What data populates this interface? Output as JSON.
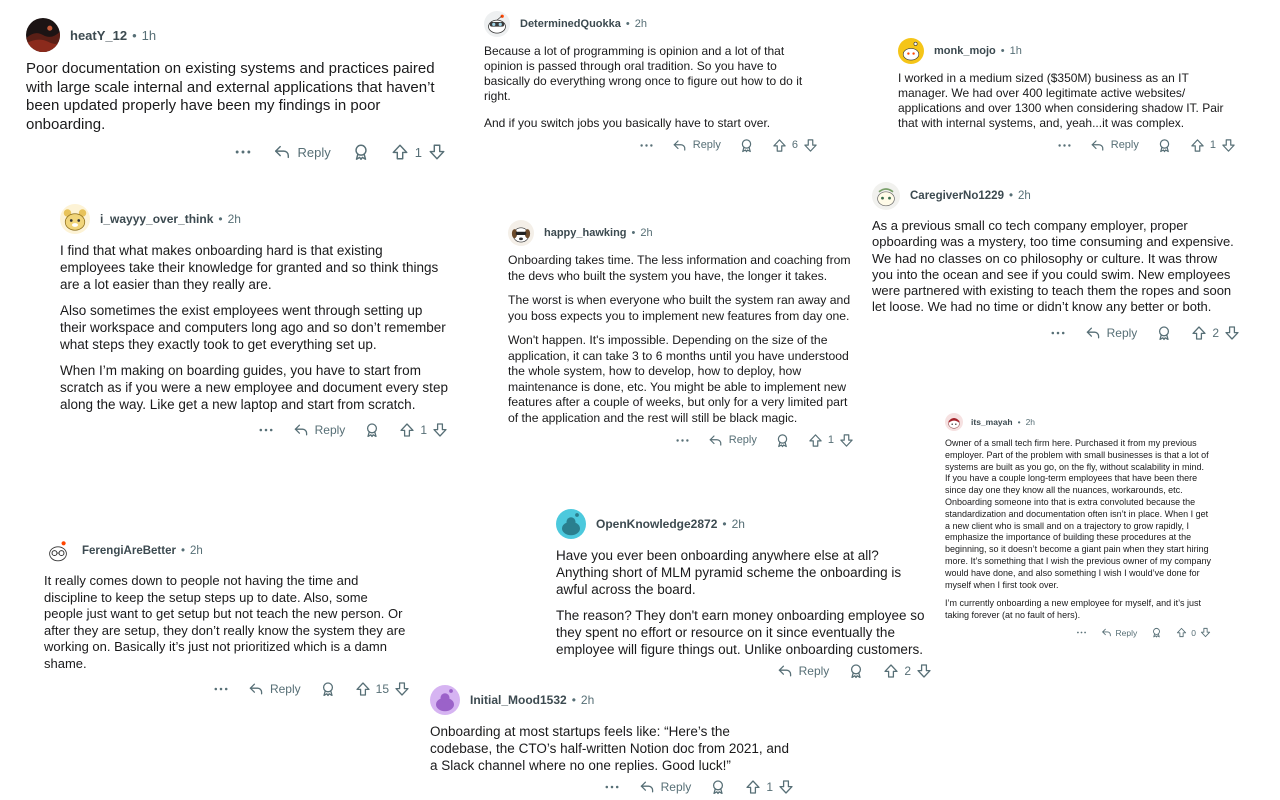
{
  "comments": [
    {
      "id": "heaty",
      "user": "heatY_12",
      "time": "1h",
      "avatar": "dark-landscape",
      "paragraphs": [
        "Poor documentation on existing systems and practices paired with large scale internal and external applications that haven’t been updated properly have been my findings in poor onboarding."
      ],
      "reply_label": "Reply",
      "score": "1",
      "show_more": true,
      "show_award": true
    },
    {
      "id": "quokka",
      "user": "DeterminedQuokka",
      "time": "2h",
      "avatar": "snoo-goggles",
      "paragraphs": [
        "Because a lot of programming is opinion and a lot of that opinion is passed through oral tradition. So you have to basically do everything wrong once to figure out how to do it right.",
        "And if you switch jobs you basically have to start over."
      ],
      "reply_label": "Reply",
      "score": "6",
      "show_more": true,
      "show_award": true
    },
    {
      "id": "monk",
      "user": "monk_mojo",
      "time": "1h",
      "avatar": "snoo-yellow",
      "paragraphs": [
        "I worked in a medium sized ($350M) business as an IT manager. We had over 400 legitimate active websites/ applications and over 1300 when considering shadow IT. Pair that with internal systems, and, yeah...it was complex."
      ],
      "reply_label": "Reply",
      "score": "1",
      "show_more": true,
      "show_award": true
    },
    {
      "id": "wayyy",
      "user": "i_wayyy_over_think",
      "time": "2h",
      "avatar": "snoo-bear",
      "paragraphs": [
        "I find that what makes onboarding hard is that existing employees take their knowledge for granted and so think things are a lot easier than they really are.",
        "Also sometimes the exist employees went through setting up their workspace and computers long ago and so don’t remember what steps they exactly took to get everything set up.",
        "When I’m making on boarding guides, you have to start from scratch as if you were a new employee and document every step along the way. Like get a new laptop and start from scratch."
      ],
      "reply_label": "Reply",
      "score": "1",
      "show_more": true,
      "show_award": true
    },
    {
      "id": "hawking",
      "user": "happy_hawking",
      "time": "2h",
      "avatar": "snoo-dog",
      "paragraphs": [
        "Onboarding takes time. The less information and coaching from the devs who built the system you have, the longer it takes.",
        "The worst is when everyone who built the system ran away and you boss expects you to implement new features from day one.",
        "Won't happen. It's impossible. Depending on the size of the application, it can take 3 to 6 months until you have understood the whole system, how to develop, how to deploy, how maintenance is done, etc. You might be able to implement new features after a couple of weeks, but only for a very limited part of the application and the rest will still be black magic."
      ],
      "reply_label": "Reply",
      "score": "1",
      "show_more": true,
      "show_award": true
    },
    {
      "id": "caregiver",
      "user": "CaregiverNo1229",
      "time": "2h",
      "avatar": "snoo-pale",
      "paragraphs": [
        "As a previous small co tech company employer, proper opboarding was a mystery, too time consuming and expensive. We had no classes on co philosophy or culture. It was throw you into the ocean and see if you could swim. New employees were partnered with existing to teach them the ropes and soon let loose. We had no time or didn’t know any better or both."
      ],
      "reply_label": "Reply",
      "score": "2",
      "show_more": true,
      "show_award": true
    },
    {
      "id": "mayah",
      "user": "its_mayah",
      "time": "2h",
      "avatar": "snoo-red",
      "paragraphs": [
        "Owner of a small tech firm here. Purchased it from my previous employer. Part of the problem with small businesses is that a lot of systems are built as you go, on the fly, without scalability in mind. If you have a couple long-term employees that have been there since day one they know all the nuances, workarounds, etc. Onboarding someone into that is extra convoluted because the standardization and documentation often isn’t in place. When I get a new client who is small and on a trajectory to grow rapidly, I emphasize the importance of building these procedures at the beginning, so it doesn’t become a giant pain when they start hiring more. It’s something that I wish the previous owner of my company would have done, and also something I wish I would’ve done for myself when I first took over.",
        "I’m currently onboarding a new employee for myself, and it’s just taking forever (at no fault of hers)."
      ],
      "reply_label": "Reply",
      "score": "0",
      "show_more": true,
      "show_award": true
    },
    {
      "id": "ferengi",
      "user": "FerengiAreBetter",
      "time": "2h",
      "avatar": "snoo-glasses",
      "paragraphs": [
        "It really comes down to people not having the time and discipline to keep the setup steps up to date. Also, some people just want to get setup but not teach the new person. Or after they are setup, they don’t really know the system they are working on.  Basically it’s just not prioritized which is a damn shame."
      ],
      "reply_label": "Reply",
      "score": "15",
      "show_more": true,
      "show_award": true
    },
    {
      "id": "openknowledge",
      "user": "OpenKnowledge2872",
      "time": "2h",
      "avatar": "snoo-teal",
      "paragraphs": [
        "Have you ever been onboarding anywhere else at all? Anything short of MLM pyramid scheme the onboarding is awful across the board.",
        "The reason? They don't earn money onboarding employee so they spent no effort or resource on it since eventually the employee will figure things out. Unlike onboarding customers."
      ],
      "reply_label": "Reply",
      "score": "2",
      "show_more": false,
      "show_award": true
    },
    {
      "id": "initialmood",
      "user": "Initial_Mood1532",
      "time": "2h",
      "avatar": "snoo-purple",
      "paragraphs": [
        "Onboarding at most startups feels like: “Here’s the codebase, the CTO’s half-written Notion doc from 2021, and a Slack channel where no one replies. Good luck!”"
      ],
      "reply_label": "Reply",
      "score": "1",
      "show_more": true,
      "show_award": true
    }
  ],
  "colors": {
    "meta_text": "#576f76",
    "username": "#3c4a50",
    "body_text": "#1a1a1b"
  }
}
